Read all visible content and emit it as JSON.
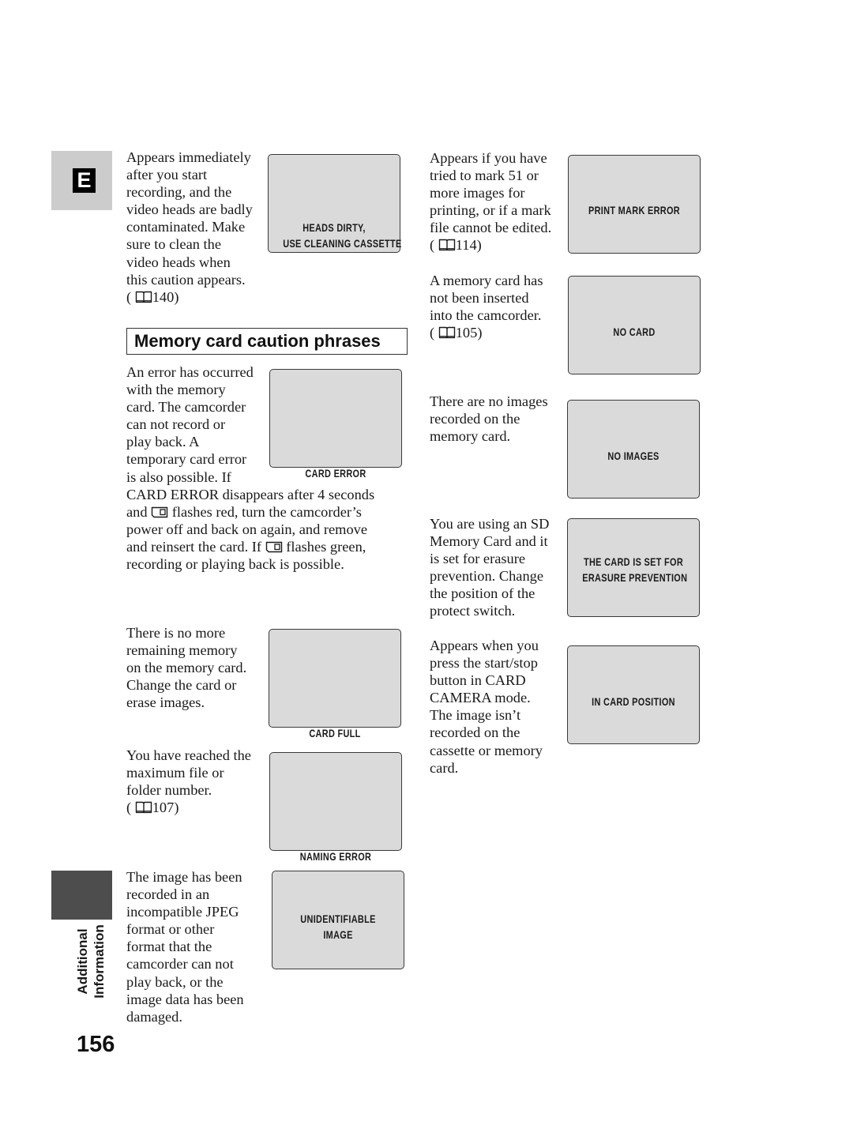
{
  "page": {
    "language_tab": "E",
    "section_tab": "Additional\nInformation",
    "page_number": "156"
  },
  "section_heading": "Memory card caution phrases",
  "icons": {
    "book": "book-reference-icon",
    "card": "memory-card-icon"
  },
  "colors": {
    "screen_fill": "#dadada",
    "screen_border": "#3a3a3a",
    "tab_light": "#cccccc",
    "tab_dark": "#4d4d4d"
  },
  "cautions": [
    {
      "id": "heads-dirty",
      "screen": "HEADS DIRTY,\nUSE CLEANING CASSETTE",
      "lines": [
        "Appears immediately",
        "after you start",
        "recording, and the",
        "video heads are badly",
        "contaminated. Make",
        "sure to clean the",
        "video heads when",
        "this caution appears."
      ],
      "ref_page": "140"
    },
    {
      "id": "card-error",
      "screen": "CARD ERROR",
      "lines": [
        "An error has occurred",
        "with the memory",
        "card. The camcorder",
        "can not record or",
        "play back. A",
        "temporary card error",
        "is also possible. If"
      ],
      "cont": {
        "l1": "CARD ERROR disappears after 4 seconds",
        "l2a": "and ",
        "l2b": " flashes red, turn the camcorder’s",
        "l3": "power off and back on again, and remove",
        "l4a": "and reinsert the card. If ",
        "l4b": " flashes green,",
        "l5": "recording or playing back is possible."
      }
    },
    {
      "id": "card-full",
      "screen": "CARD FULL",
      "lines": [
        "There is no more",
        "remaining memory",
        "on the memory card.",
        "Change the card or",
        "erase images."
      ]
    },
    {
      "id": "naming-error",
      "screen": "NAMING ERROR",
      "lines": [
        "You have reached the",
        "maximum file or",
        "folder number."
      ],
      "ref_page": "107"
    },
    {
      "id": "unidentifiable-image",
      "screen": "UNIDENTIFIABLE\nIMAGE",
      "lines": [
        "The image has been",
        "recorded in an",
        "incompatible JPEG",
        "format or other",
        "format that the",
        "camcorder can not",
        "play back, or the",
        "image data has been",
        "damaged."
      ]
    },
    {
      "id": "print-mark-error",
      "screen": "PRINT MARK ERROR",
      "lines": [
        "Appears if you have",
        "tried to mark 51 or",
        "more images for",
        "printing, or if a mark",
        "file cannot be edited."
      ],
      "ref_page": "114"
    },
    {
      "id": "no-card",
      "screen": "NO CARD",
      "lines": [
        "A memory card has",
        "not been inserted",
        "into the camcorder."
      ],
      "ref_page": "105"
    },
    {
      "id": "no-images",
      "screen": "NO IMAGES",
      "lines": [
        "There are no images",
        "recorded on the",
        "memory card."
      ]
    },
    {
      "id": "erasure-prevention",
      "screen": "THE CARD IS SET FOR\nERASURE PREVENTION",
      "lines": [
        "You are using an SD",
        "Memory Card and it",
        "is set for erasure",
        "prevention. Change",
        "the position of the",
        "protect switch."
      ]
    },
    {
      "id": "in-card-position",
      "screen": "IN CARD POSITION",
      "lines": [
        "Appears when you",
        "press the start/stop",
        "button in CARD",
        "CAMERA mode.",
        "The image isn’t",
        "recorded on the",
        "cassette or memory",
        "card."
      ]
    }
  ]
}
